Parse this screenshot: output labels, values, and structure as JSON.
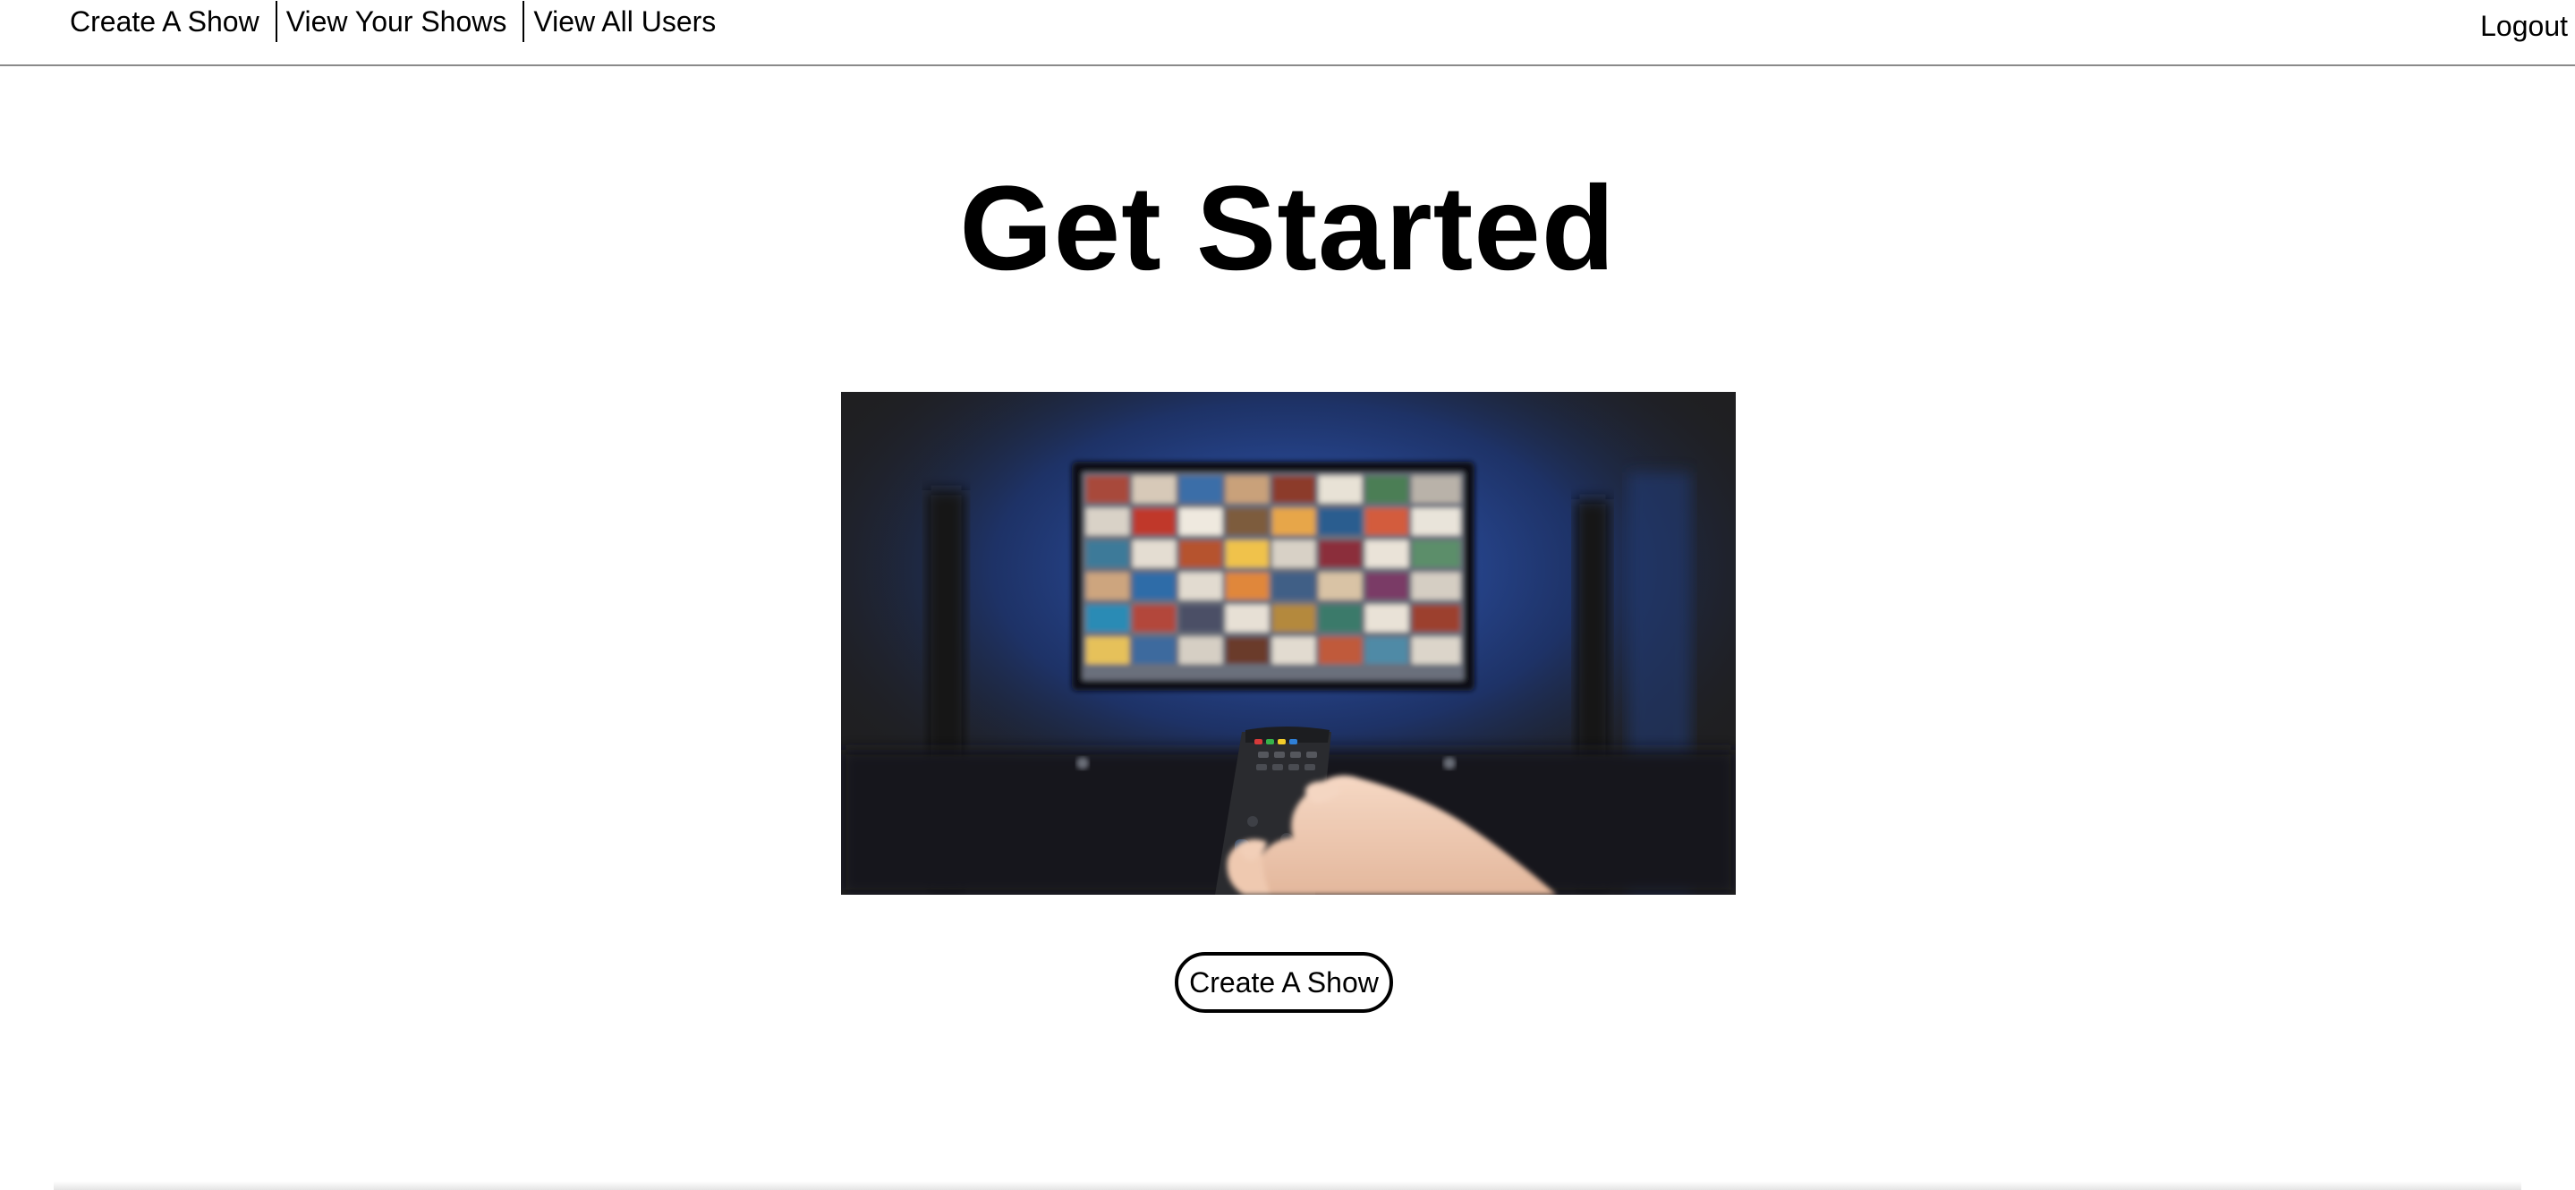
{
  "nav": {
    "links": [
      {
        "label": "Create A Show"
      },
      {
        "label": "View Your Shows"
      },
      {
        "label": "View All Users"
      }
    ],
    "logout_label": "Logout"
  },
  "hero": {
    "title": "Get Started",
    "image_subject": "hand-holding-tv-remote-in-front-of-streaming-screen",
    "cta_label": "Create A Show"
  },
  "colors": {
    "image_background": "#1f1f21",
    "screen_glow": "#2a56c8",
    "nav_border": "#8a8a8a"
  }
}
